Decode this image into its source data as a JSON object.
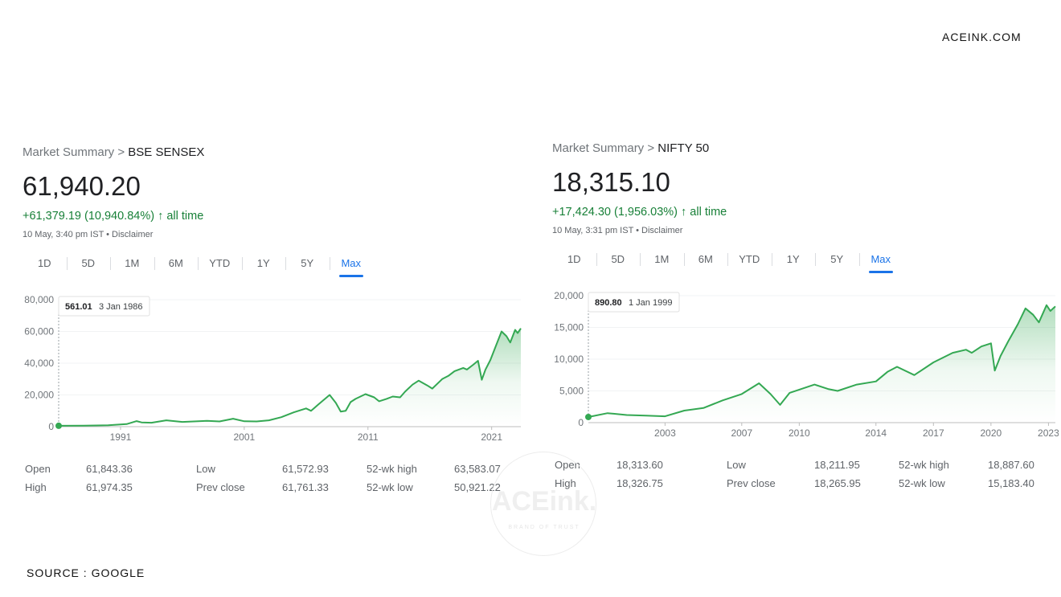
{
  "brand": "ACEINK.COM",
  "source": "SOURCE : GOOGLE",
  "watermark": {
    "text": "ACEink.",
    "sub": "BRAND OF TRUST"
  },
  "colors": {
    "up": "#188038",
    "line": "#34a853",
    "active_tab": "#1a73e8",
    "muted": "#5f6368"
  },
  "panels": [
    {
      "breadcrumb_root": "Market Summary",
      "breadcrumb_sep": " > ",
      "breadcrumb_current": "BSE SENSEX",
      "price": "61,940.20",
      "change": "+61,379.19 (10,940.84%)",
      "change_period": "all time",
      "change_icon": "arrow-up-icon",
      "timestamp": "10 May, 3:40 pm IST • Disclaimer",
      "ranges": [
        "1D",
        "5D",
        "1M",
        "6M",
        "YTD",
        "1Y",
        "5Y",
        "Max"
      ],
      "active_range": "Max",
      "tooltip": {
        "value": "561.01",
        "date": "3 Jan 1986"
      },
      "stats": [
        {
          "label": "Open",
          "value": "61,843.36"
        },
        {
          "label": "High",
          "value": "61,974.35"
        },
        {
          "label": "Low",
          "value": "61,572.93"
        },
        {
          "label": "Prev close",
          "value": "61,761.33"
        },
        {
          "label": "52-wk high",
          "value": "63,583.07"
        },
        {
          "label": "52-wk low",
          "value": "50,921.22"
        }
      ]
    },
    {
      "breadcrumb_root": "Market Summary",
      "breadcrumb_sep": " > ",
      "breadcrumb_current": "NIFTY 50",
      "price": "18,315.10",
      "change": "+17,424.30 (1,956.03%)",
      "change_period": "all time",
      "change_icon": "arrow-up-icon",
      "timestamp": "10 May, 3:31 pm IST • Disclaimer",
      "ranges": [
        "1D",
        "5D",
        "1M",
        "6M",
        "YTD",
        "1Y",
        "5Y",
        "Max"
      ],
      "active_range": "Max",
      "tooltip": {
        "value": "890.80",
        "date": "1 Jan 1999"
      },
      "stats": [
        {
          "label": "Open",
          "value": "18,313.60"
        },
        {
          "label": "High",
          "value": "18,326.75"
        },
        {
          "label": "Low",
          "value": "18,211.95"
        },
        {
          "label": "Prev close",
          "value": "18,265.95"
        },
        {
          "label": "52-wk high",
          "value": "18,887.60"
        },
        {
          "label": "52-wk low",
          "value": "15,183.40"
        }
      ]
    }
  ],
  "chart_data": [
    {
      "type": "area",
      "title": "BSE SENSEX",
      "xlabel": "",
      "ylabel": "",
      "xlim": [
        1986.0,
        2023.36
      ],
      "ylim": [
        0,
        80000
      ],
      "y_ticks": [
        0,
        20000,
        40000,
        60000,
        80000
      ],
      "y_tick_labels": [
        "0",
        "20,000",
        "40,000",
        "60,000",
        "80,000"
      ],
      "x_ticks": [
        1991,
        2001,
        2011,
        2021
      ],
      "x_tick_labels": [
        "1991",
        "2001",
        "2011",
        "2021"
      ],
      "grid": true,
      "legend": "none",
      "series": [
        {
          "x": [
            1986.0,
            1988.0,
            1990.0,
            1991.5,
            1992.3,
            1992.7,
            1993.5,
            1994.7,
            1996.0,
            1998.0,
            1999.0,
            2000.1,
            2001.0,
            2002.0,
            2003.0,
            2004.0,
            2005.0,
            2006.0,
            2006.4,
            2007.0,
            2007.9,
            2008.4,
            2008.8,
            2009.2,
            2009.6,
            2010.0,
            2010.8,
            2011.5,
            2011.9,
            2012.5,
            2013.0,
            2013.6,
            2014.0,
            2014.6,
            2015.1,
            2015.8,
            2016.2,
            2017.0,
            2017.5,
            2018.0,
            2018.7,
            2019.0,
            2019.5,
            2019.9,
            2020.2,
            2020.5,
            2020.9,
            2021.4,
            2021.8,
            2022.2,
            2022.5,
            2022.9,
            2023.1,
            2023.36
          ],
          "y": [
            561,
            600,
            900,
            1600,
            3500,
            2700,
            2500,
            4000,
            3000,
            3700,
            3300,
            5000,
            3400,
            3300,
            4000,
            6000,
            9000,
            11500,
            10000,
            14000,
            20000,
            15000,
            9500,
            10000,
            15500,
            17500,
            20500,
            18500,
            16000,
            17500,
            19000,
            18500,
            22000,
            26500,
            29000,
            26000,
            24000,
            30000,
            32000,
            35000,
            37000,
            36000,
            39000,
            41500,
            29500,
            36000,
            42000,
            52000,
            60000,
            57000,
            53000,
            61000,
            59000,
            61940
          ]
        }
      ],
      "annotations": [
        {
          "x": 1986.0,
          "y": 561.01,
          "text": "561.01 3 Jan 1986"
        }
      ]
    },
    {
      "type": "area",
      "title": "NIFTY 50",
      "xlabel": "",
      "ylabel": "",
      "xlim": [
        1999.0,
        2023.36
      ],
      "ylim": [
        0,
        20000
      ],
      "y_ticks": [
        0,
        5000,
        10000,
        15000,
        20000
      ],
      "y_tick_labels": [
        "0",
        "5,000",
        "10,000",
        "15,000",
        "20,000"
      ],
      "x_ticks": [
        2003,
        2007,
        2010,
        2014,
        2017,
        2020,
        2023
      ],
      "x_tick_labels": [
        "2003",
        "2007",
        "2010",
        "2014",
        "2017",
        "2020",
        "2023"
      ],
      "grid": true,
      "legend": "none",
      "series": [
        {
          "x": [
            1999.0,
            2000.0,
            2001.0,
            2002.0,
            2003.0,
            2004.0,
            2005.0,
            2006.0,
            2007.0,
            2007.9,
            2008.5,
            2009.0,
            2009.5,
            2010.0,
            2010.8,
            2011.5,
            2012.0,
            2013.0,
            2014.0,
            2014.6,
            2015.1,
            2016.0,
            2017.0,
            2018.0,
            2018.7,
            2019.0,
            2019.5,
            2020.0,
            2020.2,
            2020.5,
            2020.9,
            2021.4,
            2021.8,
            2022.2,
            2022.5,
            2022.9,
            2023.1,
            2023.36
          ],
          "y": [
            891,
            1500,
            1200,
            1100,
            1000,
            1900,
            2300,
            3500,
            4500,
            6200,
            4500,
            2800,
            4700,
            5200,
            6000,
            5300,
            5000,
            6000,
            6500,
            8000,
            8800,
            7500,
            9500,
            11000,
            11500,
            11000,
            12000,
            12500,
            8200,
            10500,
            12800,
            15500,
            18000,
            17000,
            15800,
            18500,
            17600,
            18315
          ]
        }
      ],
      "annotations": [
        {
          "x": 1999.0,
          "y": 890.8,
          "text": "890.80 1 Jan 1999"
        }
      ]
    }
  ]
}
